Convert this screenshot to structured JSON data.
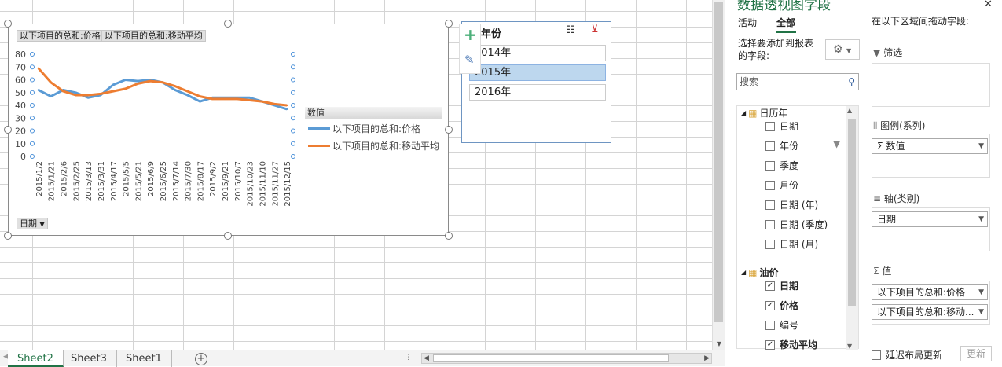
{
  "sheet_tabs": [
    "Sheet2",
    "Sheet3",
    "Sheet1"
  ],
  "chart": {
    "field_buttons": [
      "以下项目的总和:价格",
      "以下项目的总和:移动平均"
    ],
    "axis_field_button": "日期",
    "legend_title": "数值",
    "legend": [
      "以下项目的总和:价格",
      "以下项目的总和:移动平均"
    ],
    "y_ticks": [
      "80",
      "70",
      "60",
      "50",
      "40",
      "30",
      "20",
      "10",
      "0"
    ],
    "x_ticks": [
      "2015/1/2",
      "2015/1/21",
      "2015/2/6",
      "2015/2/25",
      "2015/3/13",
      "2015/3/31",
      "2015/4/17",
      "2015/5/5",
      "2015/5/21",
      "2015/6/9",
      "2015/6/25",
      "2015/7/14",
      "2015/7/30",
      "2015/8/17",
      "2015/9/2",
      "2015/9/21",
      "2015/10/7",
      "2015/10/23",
      "2015/11/10",
      "2015/11/27",
      "2015/12/15"
    ]
  },
  "chart_data": {
    "type": "line",
    "ylim": [
      0,
      80
    ],
    "x": [
      "2015/1/2",
      "2015/1/21",
      "2015/2/6",
      "2015/2/25",
      "2015/3/13",
      "2015/3/31",
      "2015/4/17",
      "2015/5/5",
      "2015/5/21",
      "2015/6/9",
      "2015/6/25",
      "2015/7/14",
      "2015/7/30",
      "2015/8/17",
      "2015/9/2",
      "2015/9/21",
      "2015/10/7",
      "2015/10/23",
      "2015/11/10",
      "2015/11/27",
      "2015/12/15"
    ],
    "series": [
      {
        "name": "以下项目的总和:价格",
        "color": "#5b9bd5",
        "values": [
          52,
          47,
          52,
          50,
          46,
          48,
          56,
          60,
          59,
          60,
          58,
          52,
          48,
          43,
          46,
          46,
          46,
          46,
          43,
          40,
          37
        ]
      },
      {
        "name": "以下项目的总和:移动平均",
        "color": "#ed7d31",
        "values": [
          69,
          58,
          51,
          48,
          48,
          49,
          51,
          53,
          57,
          59,
          58,
          55,
          51,
          47,
          45,
          45,
          45,
          44,
          43,
          41,
          40
        ]
      }
    ],
    "legend_position": "right"
  },
  "slicer": {
    "title": "年份",
    "items": [
      "2014年",
      "2015年",
      "2016年"
    ],
    "selected": "2015年"
  },
  "pivot_pane": {
    "title": "数据透视图字段",
    "tabs": [
      "活动",
      "全部"
    ],
    "active_tab": "全部",
    "choose_label": "选择要添加到报表的字段:",
    "search_placeholder": "搜索",
    "table1": {
      "name": "日历年",
      "fields": [
        "日期",
        "年份",
        "季度",
        "月份",
        "日期 (年)",
        "日期 (季度)",
        "日期 (月)"
      ]
    },
    "table2": {
      "name": "油价",
      "fields": [
        "日期",
        "价格",
        "编号",
        "移动平均"
      ],
      "checked": [
        true,
        true,
        false,
        true
      ]
    },
    "drag_label": "在以下区域间拖动字段:",
    "zones": {
      "filter": "筛选",
      "legend": "图例(系列)",
      "legend_items": [
        "数值"
      ],
      "axis": "轴(类别)",
      "axis_items": [
        "日期"
      ],
      "values": "值",
      "values_items": [
        "以下项目的总和:价格",
        "以下项目的总和:移动..."
      ]
    },
    "defer_label": "延迟布局更新",
    "update_button": "更新"
  }
}
